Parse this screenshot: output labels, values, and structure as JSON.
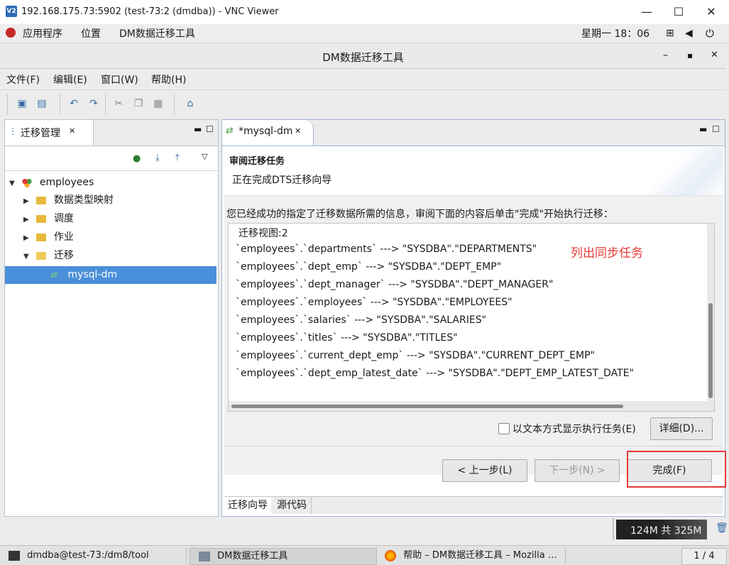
{
  "vnc": {
    "title": "192.168.175.73:5902 (test-73:2 (dmdba)) - VNC Viewer",
    "logo_text": "V2",
    "minimize": "—",
    "maximize": "☐",
    "close": "✕"
  },
  "gnome": {
    "apps": "应用程序",
    "places": "位置",
    "current_app": "DM数据迁移工具",
    "clock": "星期一 18：06"
  },
  "app": {
    "title": "DM数据迁移工具",
    "minimize": "–",
    "restore": "▪",
    "close": "✕"
  },
  "menu": {
    "file": "文件(F)",
    "edit": "编辑(E)",
    "window": "窗口(W)",
    "help": "帮助(H)"
  },
  "left_panel": {
    "tab_label": "迁移管理",
    "tab_close": "✕",
    "tree": {
      "root": "employees",
      "items": [
        "数据类型映射",
        "调度",
        "作业",
        "迁移"
      ],
      "selected": "mysql-dm"
    }
  },
  "right_panel": {
    "tab_label": "*mysql-dm",
    "tab_close": "✕",
    "wizard_title": "审阅迁移任务",
    "wizard_subtitle": "正在完成DTS迁移向导",
    "instruction": "您已经成功的指定了迁移数据所需的信息，审阅下面的内容后单击\"完成\"开始执行迁移：",
    "summary_lines": [
      "迁移视图:2",
      "`employees`.`departments` ---> \"SYSDBA\".\"DEPARTMENTS\"",
      "`employees`.`dept_emp` ---> \"SYSDBA\".\"DEPT_EMP\"",
      "`employees`.`dept_manager` ---> \"SYSDBA\".\"DEPT_MANAGER\"",
      "`employees`.`employees` ---> \"SYSDBA\".\"EMPLOYEES\"",
      "`employees`.`salaries` ---> \"SYSDBA\".\"SALARIES\"",
      "`employees`.`titles` ---> \"SYSDBA\".\"TITLES\"",
      "`employees`.`current_dept_emp` ---> \"SYSDBA\".\"CURRENT_DEPT_EMP\"",
      "`employees`.`dept_emp_latest_date` ---> \"SYSDBA\".\"DEPT_EMP_LATEST_DATE\""
    ],
    "annotation": "列出同步任务",
    "show_text_checkbox": "以文本方式显示执行任务(E)",
    "detail_button": "详细(D)...",
    "prev_button": "< 上一步(L)",
    "next_button": "下一步(N) >",
    "finish_button": "完成(F)",
    "bottom_tabs": [
      "迁移向导",
      "源代码"
    ]
  },
  "status": {
    "memory": "124M 共 325M"
  },
  "taskbar": {
    "terminal": "dmdba@test-73:/dm8/tool",
    "dmtool": "DM数据迁移工具",
    "firefox": "帮助 – DM数据迁移工具 – Mozilla …",
    "workspace": "1 / 4"
  },
  "colors": {
    "selection": "#4a8fd9",
    "annotation": "#e53935",
    "highlight_box": "#e53935"
  }
}
